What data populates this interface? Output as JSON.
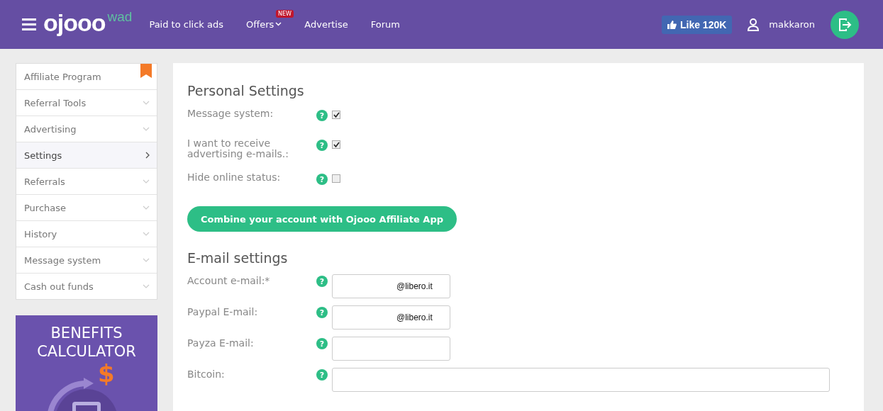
{
  "header": {
    "logo": "ojooo",
    "logo_suffix": "wad",
    "nav": [
      {
        "label": "Paid to click ads",
        "dropdown": false
      },
      {
        "label": "Offers",
        "dropdown": true,
        "badge": "NEW"
      },
      {
        "label": "Advertise",
        "dropdown": false
      },
      {
        "label": "Forum",
        "dropdown": false
      }
    ],
    "like": "Like 120K",
    "username": "makkaron"
  },
  "sidebar": {
    "items": [
      {
        "label": "Affiliate Program",
        "kind": "bookmark",
        "selected": false
      },
      {
        "label": "Referral Tools",
        "kind": "expand",
        "selected": false
      },
      {
        "label": "Advertising",
        "kind": "expand",
        "selected": false
      },
      {
        "label": "Settings",
        "kind": "expand",
        "selected": true
      },
      {
        "label": "Referrals",
        "kind": "expand",
        "selected": false
      },
      {
        "label": "Purchase",
        "kind": "expand",
        "selected": false
      },
      {
        "label": "History",
        "kind": "expand",
        "selected": false
      },
      {
        "label": "Message system",
        "kind": "expand",
        "selected": false
      },
      {
        "label": "Cash out funds",
        "kind": "expand",
        "selected": false
      }
    ],
    "banner": {
      "title_lines": [
        "BENEFITS",
        "CALCULATOR"
      ],
      "symbol": "$"
    }
  },
  "personal": {
    "title": "Personal Settings",
    "options": [
      {
        "label": "Message system:",
        "help": "?",
        "checked": true
      },
      {
        "label": "I want to receive advertising e-mails.:",
        "help": "?",
        "checked": true
      },
      {
        "label": "Hide online status:",
        "help": "?",
        "checked": false
      }
    ],
    "button": "Combine your account with Ojooo Affiliate App"
  },
  "email": {
    "title": "E-mail settings",
    "fields": [
      {
        "label": "Account e-mail:*",
        "help": "?",
        "value": "@libero.it",
        "wide": false
      },
      {
        "label": "Paypal E-mail:",
        "help": "?",
        "value": "@libero.it",
        "wide": false
      },
      {
        "label": "Payza E-mail:",
        "help": "?",
        "wide": false
      },
      {
        "label": "Bitcoin:",
        "help": "?",
        "wide": true
      }
    ]
  }
}
